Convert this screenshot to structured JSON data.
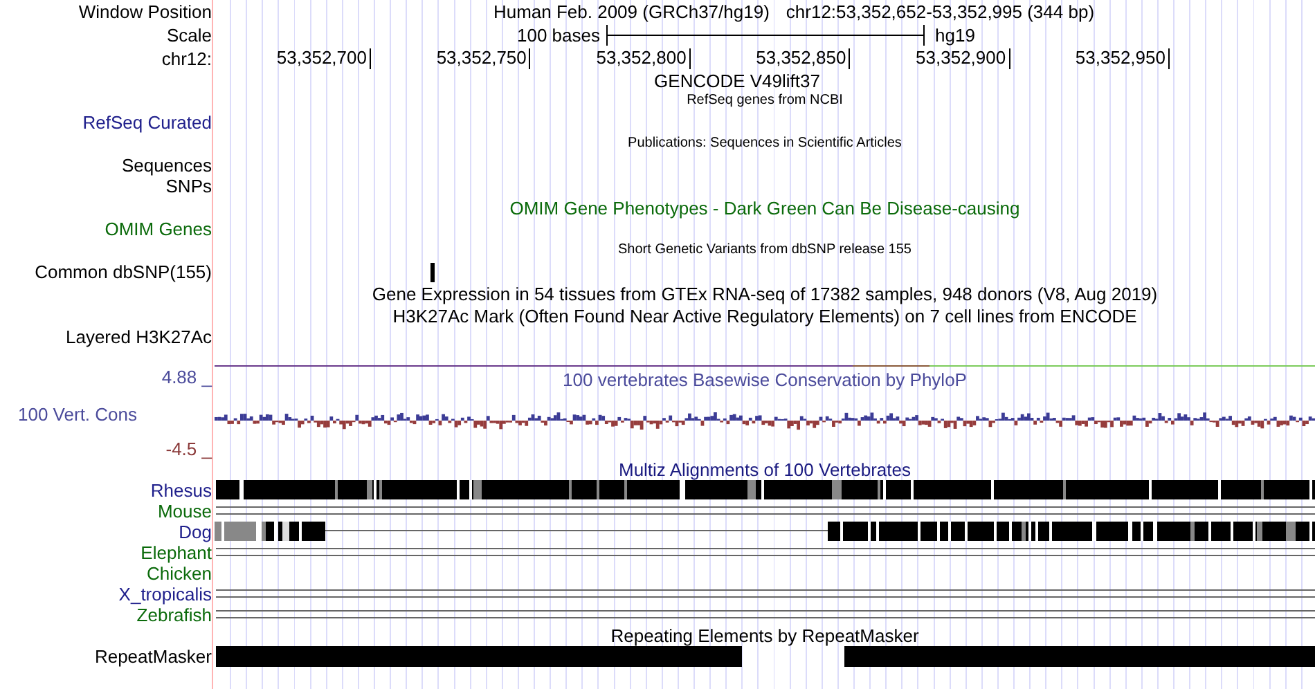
{
  "header": {
    "label": "Window Position",
    "assembly": "Human Feb. 2009 (GRCh37/hg19)",
    "position": "chr12:53,352,652-53,352,995 (344 bp)"
  },
  "scale": {
    "label": "Scale",
    "length": "100 bases",
    "assembly": "hg19"
  },
  "ruler": {
    "label": "chr12:",
    "ticks": [
      "53,352,700",
      "53,352,750",
      "53,352,800",
      "53,352,850",
      "53,352,900",
      "53,352,950"
    ]
  },
  "rows": [
    {
      "kind": "title",
      "title": "GENCODE V49lift37"
    },
    {
      "kind": "caption",
      "title": "RefSeq genes from NCBI"
    },
    {
      "kind": "label",
      "label": "RefSeq Curated",
      "color": "#20208c"
    },
    {
      "kind": "caption",
      "title": "Publications: Sequences in Scientific Articles"
    },
    {
      "kind": "label",
      "label": "Sequences",
      "color": "#000000"
    },
    {
      "kind": "label",
      "label": "SNPs",
      "color": "#000000"
    },
    {
      "kind": "title",
      "title": "OMIM Gene Phenotypes - Dark Green Can Be Disease-causing",
      "color": "#0a6a0a"
    },
    {
      "kind": "label",
      "label": "OMIM Genes",
      "color": "#0a6a0a"
    },
    {
      "kind": "caption",
      "title": "Short Genetic Variants from dbSNP release 155"
    },
    {
      "kind": "snp",
      "label": "Common dbSNP(155)",
      "color": "#000000"
    },
    {
      "kind": "title",
      "title": "Gene Expression in 54 tissues from GTEx RNA-seq of 17382 samples, 948 donors (V8, Aug 2019)"
    },
    {
      "kind": "title",
      "title": "H3K27Ac Mark (Often Found Near Active Regulatory Elements) on 7 cell lines from ENCODE"
    },
    {
      "kind": "label",
      "label": "Layered H3K27Ac",
      "color": "#000000"
    }
  ],
  "conservation": {
    "label": "100 Vert. Cons",
    "title": "100 vertebrates Basewise Conservation by PhyloP",
    "max": "4.88 _",
    "min": "-4.5 _"
  },
  "multiz": {
    "title": "Multiz Alignments of 100 Vertebrates",
    "species": [
      {
        "name": "Rhesus",
        "color": "#20208c",
        "kind": "blocks"
      },
      {
        "name": "Mouse",
        "color": "#0a6a0a",
        "kind": "lines"
      },
      {
        "name": "Dog",
        "color": "#20208c",
        "kind": "partial"
      },
      {
        "name": "Elephant",
        "color": "#0a6a0a",
        "kind": "lines"
      },
      {
        "name": "Chicken",
        "color": "#0a6a0a",
        "kind": "empty"
      },
      {
        "name": "X_tropicalis",
        "color": "#20208c",
        "kind": "lines"
      },
      {
        "name": "Zebrafish",
        "color": "#0a6a0a",
        "kind": "lines"
      }
    ]
  },
  "repeats": {
    "title": "Repeating Elements by RepeatMasker",
    "label": "RepeatMasker"
  }
}
